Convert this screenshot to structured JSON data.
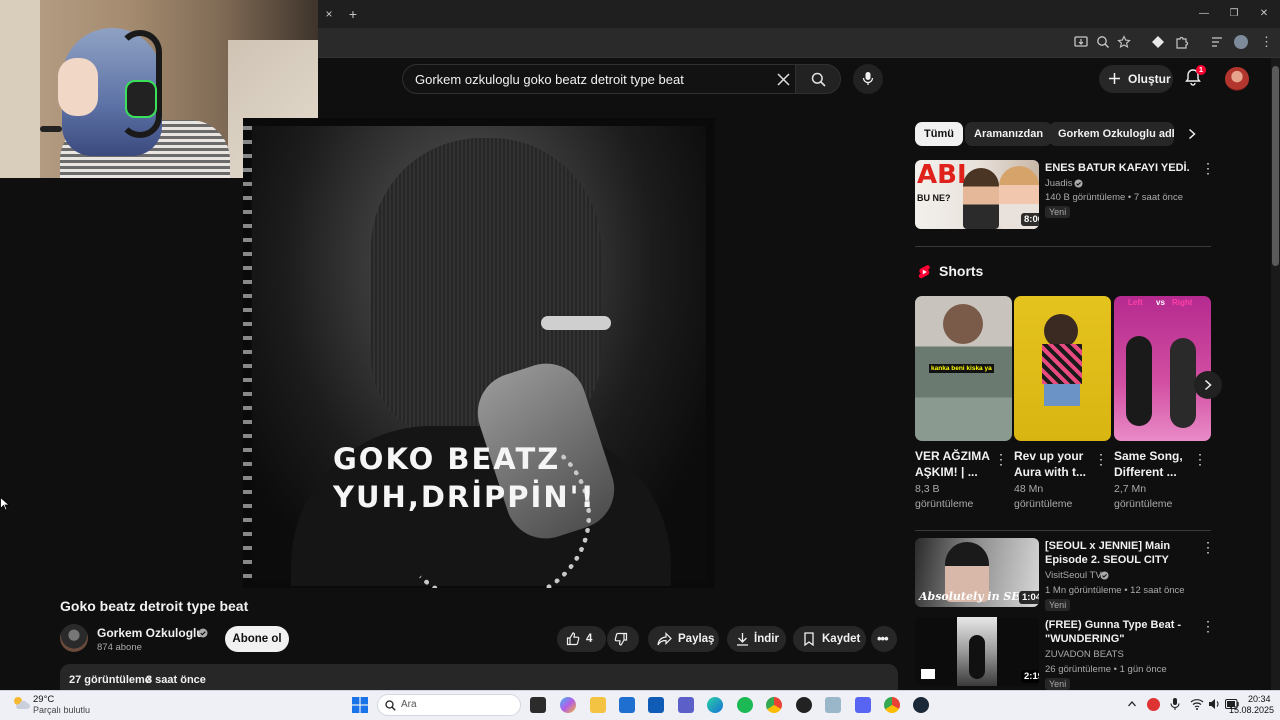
{
  "browser": {
    "tab_close": "×",
    "tab_new": "+",
    "window_controls": {
      "minimize": "—",
      "restore": "❐",
      "close": "✕"
    }
  },
  "header": {
    "search_query": "Gorkem ozkuloglu goko beatz detroit type beat",
    "create_label": "Oluştur",
    "notification_count": "1"
  },
  "video": {
    "overlay_line1": "GOKO BEATZ",
    "overlay_line2": "YUH,DRİPPİN'!",
    "title": "Goko beatz detroit type beat",
    "channel": "Gorkem Ozkuloglu",
    "subscribers": "874 abone",
    "subscribe_label": "Abone ol",
    "likes": "4",
    "share_label": "Paylaş",
    "download_label": "İndir",
    "save_label": "Kaydet",
    "views": "27 görüntüleme",
    "age": "3 saat önce"
  },
  "sidebar": {
    "chips": [
      "Tümü",
      "Aramanızdan",
      "Gorkem Ozkuloglu adlı y"
    ],
    "top_video": {
      "title": "ENES BATUR KAFAYI YEDİ.",
      "channel": "Juadis",
      "meta": "140 B görüntüleme • 7 saat önce",
      "badge": "Yeni",
      "duration": "8:06",
      "thumb_text1": "ABI",
      "thumb_text2": "BU NE?"
    },
    "shorts_heading": "Shorts",
    "shorts": [
      {
        "title": "VER AĞZIMA AŞKIM! | ...",
        "views": "8,3 B",
        "views_label": "görüntüleme"
      },
      {
        "title": "Rev up your Aura with t...",
        "views": "48 Mn",
        "views_label": "görüntüleme"
      },
      {
        "title": "Same Song, Different ...",
        "views": "2,7 Mn",
        "views_label": "görüntüleme"
      }
    ],
    "short_caption": "kankа beni kiska ya",
    "short3_left": "Left",
    "short3_vs": "vs",
    "short3_right": "Right",
    "videos": [
      {
        "title": "[SEOUL x JENNIE] Main Episode 2. SEOUL CITY",
        "channel": "VisitSeoul TV",
        "meta": "1 Mn görüntüleme • 12 saat önce",
        "badge": "Yeni",
        "duration": "1:04",
        "thumb_text": "Absolutely in SE"
      },
      {
        "title": "(FREE) Gunna Type Beat - \"WUNDERING\"",
        "channel": "ZUVADON BEATS",
        "meta": "26 görüntüleme • 1 gün önce",
        "badge": "Yeni",
        "duration": "2:19"
      }
    ]
  },
  "taskbar": {
    "weather_temp": "29°C",
    "weather_desc": "Parçalı bulutlu",
    "search_placeholder": "Ara",
    "time": "20:34",
    "date": "15.08.2025"
  },
  "colors": {
    "background": "#0f0f0f",
    "accent_red": "#ff0033",
    "chip_active_bg": "#f1f1f1"
  }
}
